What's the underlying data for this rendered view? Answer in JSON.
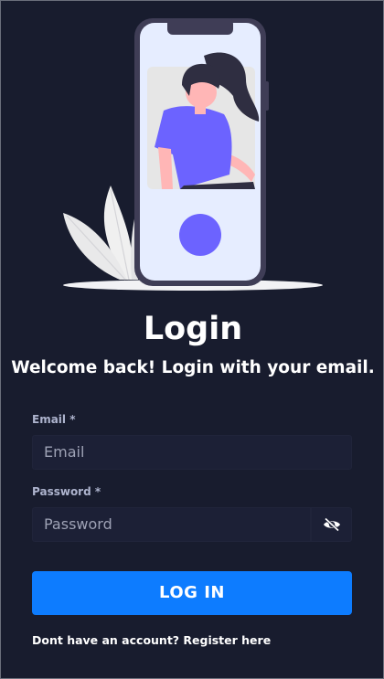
{
  "header": {
    "title": "Login",
    "subtitle": "Welcome back! Login with your email."
  },
  "form": {
    "email": {
      "label": "Email *",
      "value": "",
      "placeholder": "Email"
    },
    "password": {
      "label": "Password *",
      "value": "",
      "placeholder": "Password",
      "toggle_icon": "eye-slash-icon"
    },
    "submit_label": "LOG IN",
    "register_text": "Dont have an account? Register here"
  },
  "illustration": {
    "icon": "phone-woman-illustration"
  },
  "colors": {
    "background": "#181c2e",
    "accent": "#0d7cff",
    "illustration_accent": "#6c63ff",
    "input_bg": "#1c2036"
  }
}
